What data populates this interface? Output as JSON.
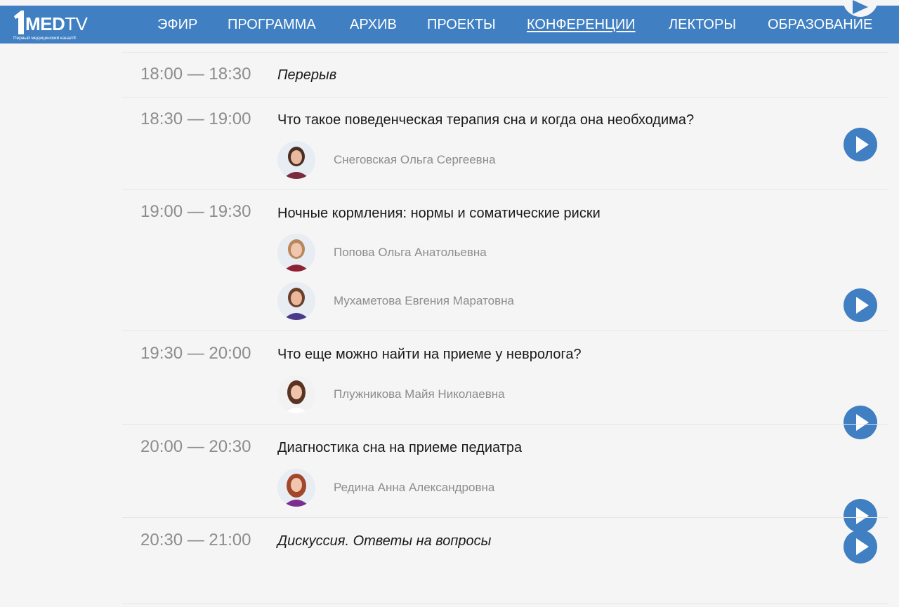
{
  "header": {
    "logo": {
      "number": "1",
      "med": "MED",
      "tv": "TV",
      "subtitle": "Первый медицинский канал®"
    },
    "nav": [
      {
        "label": "ЭФИР"
      },
      {
        "label": "ПРОГРАММА"
      },
      {
        "label": "АРХИВ"
      },
      {
        "label": "ПРОЕКТЫ"
      },
      {
        "label": "КОНФЕРЕНЦИИ",
        "active": true
      },
      {
        "label": "ЛЕКТОРЫ"
      },
      {
        "label": "ОБРАЗОВАНИЕ"
      }
    ]
  },
  "colors": {
    "brand": "#3f7fc2",
    "background": "#f5f5f5",
    "time_text": "#8c8c8c",
    "title_text": "#1a1a1a"
  },
  "schedule": [
    {
      "time": "18:00 — 18:30",
      "title": "Перерыв",
      "italic": true,
      "speakers": [],
      "play": false
    },
    {
      "time": "18:30 — 19:00",
      "title": "Что такое поведенческая терапия сна и когда она необходима?",
      "italic": false,
      "speakers": [
        {
          "name": "Снеговская Ольга Сергеевна"
        }
      ],
      "play": true
    },
    {
      "time": "19:00 — 19:30",
      "title": "Ночные кормления: нормы и соматические риски",
      "italic": false,
      "speakers": [
        {
          "name": "Попова Ольга Анатольевна"
        },
        {
          "name": "Мухаметова Евгения Маратовна"
        }
      ],
      "play": true
    },
    {
      "time": "19:30 — 20:00",
      "title": "Что еще можно найти на приеме у невролога?",
      "italic": false,
      "speakers": [
        {
          "name": "Плужникова Майя Николаевна"
        }
      ],
      "play": true
    },
    {
      "time": "20:00 — 20:30",
      "title": "Диагностика сна на приеме педиатра",
      "italic": false,
      "speakers": [
        {
          "name": "Редина Анна Александровна"
        }
      ],
      "play": true
    },
    {
      "time": "20:30 — 21:00",
      "title": "Дискуссия. Ответы на вопросы",
      "italic": true,
      "speakers": [],
      "play": true
    }
  ],
  "icons": {
    "play": "play-icon",
    "avatar": "speaker-avatar"
  }
}
